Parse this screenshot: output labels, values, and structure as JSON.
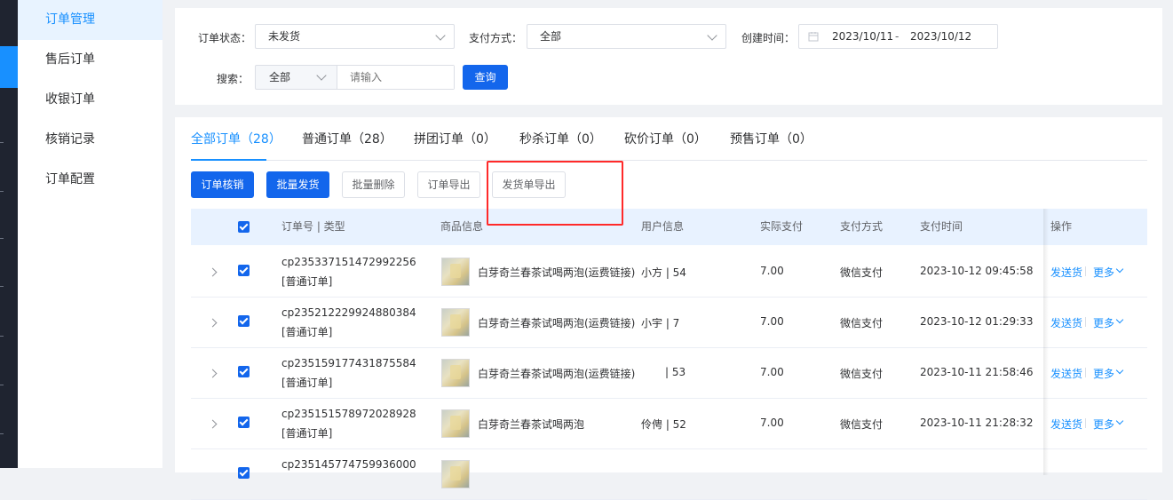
{
  "sidebar": {
    "items": [
      {
        "label": "订单管理",
        "active": true
      },
      {
        "label": "售后订单",
        "active": false
      },
      {
        "label": "收银订单",
        "active": false
      },
      {
        "label": "核销记录",
        "active": false
      },
      {
        "label": "订单配置",
        "active": false
      }
    ]
  },
  "filters": {
    "status_label": "订单状态：",
    "status_value": "未发货",
    "payment_label": "支付方式：",
    "payment_value": "全部",
    "created_label": "创建时间：",
    "date_start": "2023/10/11",
    "date_separator": "-",
    "date_end": "2023/10/12",
    "search_label": "搜索：",
    "search_scope": "全部",
    "search_placeholder": "请输入",
    "query_button": "查询"
  },
  "tabs": [
    {
      "label": "全部订单（28）",
      "active": true
    },
    {
      "label": "普通订单（28）",
      "active": false
    },
    {
      "label": "拼团订单（0）",
      "active": false
    },
    {
      "label": "秒杀订单（0）",
      "active": false
    },
    {
      "label": "砍价订单（0）",
      "active": false
    },
    {
      "label": "预售订单（0）",
      "active": false
    }
  ],
  "toolbar": {
    "verify": "订单核销",
    "batch_ship": "批量发货",
    "batch_delete": "批量删除",
    "export_orders": "订单导出",
    "export_delivery": "发货单导出"
  },
  "table": {
    "headers": {
      "order": "订单号 | 类型",
      "goods": "商品信息",
      "user": "用户信息",
      "paid": "实际支付",
      "pay_method": "支付方式",
      "pay_time": "支付时间",
      "action": "操作"
    },
    "rows": [
      {
        "order_no": "cp235337151472992256",
        "type": "[普通订单]",
        "product": "白芽奇兰春茶试喝两泡(运费链接)",
        "user": "小方 | 54",
        "paid": "7.00",
        "pay_method": "微信支付",
        "pay_time": "2023-10-12 09:45:58",
        "action_ship": "发送货",
        "action_more": "更多"
      },
      {
        "order_no": "cp235212229924880384",
        "type": "[普通订单]",
        "product": "白芽奇兰春茶试喝两泡(运费链接)",
        "user": "小宇 | 7",
        "paid": "7.00",
        "pay_method": "微信支付",
        "pay_time": "2023-10-12 01:29:33",
        "action_ship": "发送货",
        "action_more": "更多"
      },
      {
        "order_no": "cp235159177431875584",
        "type": "[普通订单]",
        "product": "白芽奇兰春茶试喝两泡(运费链接)",
        "user": "| 53",
        "paid": "7.00",
        "pay_method": "微信支付",
        "pay_time": "2023-10-11 21:58:46",
        "action_ship": "发送货",
        "action_more": "更多"
      },
      {
        "order_no": "cp235151578972028928",
        "type": "[普通订单]",
        "product": "白芽奇兰春茶试喝两泡",
        "user": "伶俜 | 52",
        "paid": "7.00",
        "pay_method": "微信支付",
        "pay_time": "2023-10-11 21:28:32",
        "action_ship": "发送货",
        "action_more": "更多"
      },
      {
        "order_no": "cp235145774759936000"
      }
    ]
  }
}
